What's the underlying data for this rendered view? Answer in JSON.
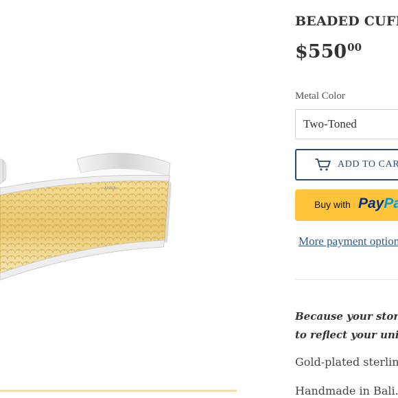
{
  "product": {
    "title": "BEADED CUFF",
    "price_dollars": "$550",
    "price_cents": "00",
    "image_alt": "Beaded cuff bracelet"
  },
  "options": {
    "metal_color_label": "Metal Color",
    "metal_color_value": "Two-Toned"
  },
  "actions": {
    "add_to_cart_label": "ADD TO CART",
    "buy_with_label": "Buy with",
    "paypal_logo_a": "Pay",
    "paypal_logo_b": "Pal",
    "more_payment_label": "More payment options"
  },
  "description": {
    "italic_line_1": "Because your story is",
    "italic_line_2": "to reflect your uniqueness",
    "line_1": "Gold-plated sterling silver",
    "line_2": "Handmade in Bali."
  },
  "colors": {
    "accent": "#2d4a6e",
    "paypal_yellow": "#ffc439",
    "link": "#2d5a8c",
    "gold": "#e6c36a",
    "silver": "#e9e9e9"
  }
}
